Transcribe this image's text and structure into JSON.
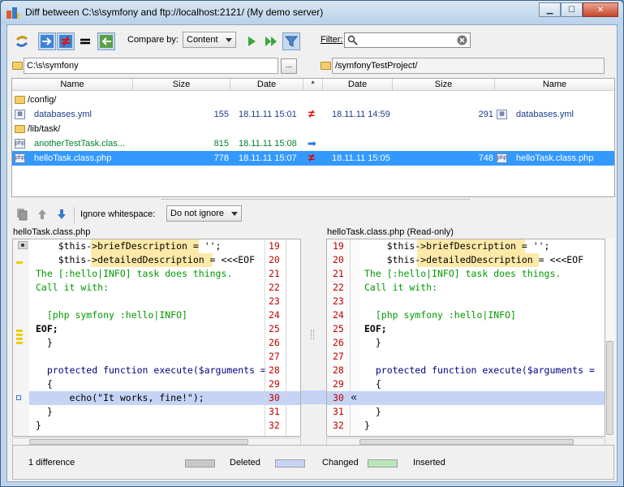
{
  "window": {
    "title": "Diff between C:\\s\\symfony and ftp://localhost:2121/ (My demo server)"
  },
  "toolbar": {
    "compare_by_label": "Compare by:",
    "compare_by_value": "Content",
    "filter_label": "Filter:",
    "filter_value": ""
  },
  "paths": {
    "left": "C:\\s\\symfony",
    "browse_label": "...",
    "right": "/symfonyTestProject/"
  },
  "table": {
    "headers": [
      "Name",
      "Size",
      "Date",
      "*",
      "Date",
      "Size",
      "Name"
    ],
    "rows": [
      {
        "type": "folder",
        "name": "/config/"
      },
      {
        "type": "file",
        "lname": "databases.yml",
        "lsize": "155",
        "ldate": "18.11.11 15:01",
        "mark": "≠",
        "rdate": "18.11.11 14:59",
        "rsize": "291",
        "rname": "databases.yml"
      },
      {
        "type": "folder",
        "name": "/lib/task/"
      },
      {
        "type": "file",
        "lname": "anotherTestTask.clas...",
        "lsize": "815",
        "ldate": "18.11.11 15:08",
        "mark": "➡",
        "rdate": "",
        "rsize": "",
        "rname": ""
      },
      {
        "type": "file",
        "lname": "helloTask.class.php",
        "lsize": "778",
        "ldate": "18.11.11 15:07",
        "mark": "≠",
        "rdate": "18.11.11 15:05",
        "rsize": "748",
        "rname": "helloTask.class.php"
      }
    ]
  },
  "diff_toolbar": {
    "ignore_ws_label": "Ignore whitespace:",
    "ignore_ws_value": "Do not ignore"
  },
  "editor": {
    "left_title": "helloTask.class.php",
    "right_title": "helloTask.class.php (Read-only)",
    "left_lines": [
      {
        "n": "19",
        "t": "    $this->briefDescription = '';"
      },
      {
        "n": "20",
        "t": "    $this->detailedDescription = <<<EOF"
      },
      {
        "n": "21",
        "t": "The [:hello|INFO] task does things."
      },
      {
        "n": "22",
        "t": "Call it with:"
      },
      {
        "n": "23",
        "t": ""
      },
      {
        "n": "24",
        "t": "  [php symfony :hello|INFO]"
      },
      {
        "n": "25",
        "t": "EOF;"
      },
      {
        "n": "26",
        "t": "  }"
      },
      {
        "n": "27",
        "t": ""
      },
      {
        "n": "28",
        "t": "  protected function execute($arguments ="
      },
      {
        "n": "29",
        "t": "  {"
      },
      {
        "n": "30",
        "t": "      echo(\"It works, fine!\");"
      },
      {
        "n": "31",
        "t": "  }"
      },
      {
        "n": "32",
        "t": "}"
      }
    ],
    "right_lines": [
      {
        "n": "19",
        "t": "    $this->briefDescription = '';"
      },
      {
        "n": "20",
        "t": "    $this->detailedDescription = <<<EOF"
      },
      {
        "n": "21",
        "t": "The [:hello|INFO] task does things."
      },
      {
        "n": "22",
        "t": "Call it with:"
      },
      {
        "n": "23",
        "t": ""
      },
      {
        "n": "24",
        "t": "  [php symfony :hello|INFO]"
      },
      {
        "n": "25",
        "t": "EOF;"
      },
      {
        "n": "26",
        "t": "  }"
      },
      {
        "n": "27",
        "t": ""
      },
      {
        "n": "28",
        "t": "  protected function execute($arguments ="
      },
      {
        "n": "29",
        "t": "  {"
      },
      {
        "n": "30",
        "t": ""
      },
      {
        "n": "31",
        "t": "  }"
      },
      {
        "n": "32",
        "t": "}"
      }
    ]
  },
  "status": {
    "differences": "1 difference",
    "legend": [
      {
        "label": "Deleted",
        "color": "#c8c8c8"
      },
      {
        "label": "Changed",
        "color": "#c5d3f5"
      },
      {
        "label": "Inserted",
        "color": "#b8e6b8"
      }
    ]
  }
}
